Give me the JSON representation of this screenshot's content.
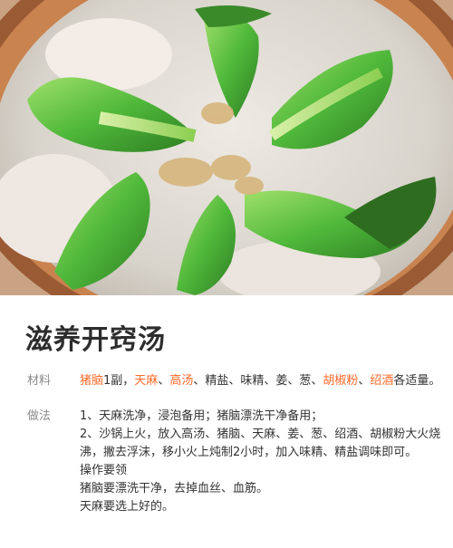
{
  "recipe": {
    "title": "滋养开窍汤",
    "materials_label": "材料",
    "materials": [
      {
        "text": "猪脑",
        "link": true
      },
      {
        "text": "1副，",
        "link": false
      },
      {
        "text": "天麻",
        "link": true
      },
      {
        "text": "、",
        "link": false
      },
      {
        "text": "高汤",
        "link": true
      },
      {
        "text": "、精盐、味精、姜、葱、",
        "link": false
      },
      {
        "text": "胡椒粉",
        "link": true
      },
      {
        "text": "、",
        "link": false
      },
      {
        "text": "绍酒",
        "link": true
      },
      {
        "text": "各适量。",
        "link": false
      }
    ],
    "method_label": "做法",
    "method_lines": [
      "1、天麻洗净，浸泡备用；猪脑漂洗干净备用；",
      "2、沙锅上火，放入高汤、猪脑、天麻、姜、葱、绍酒、胡椒粉大火烧",
      "沸，撇去浮沫，移小火上炖制2小时，加入味精、精盐调味即可。",
      "操作要领",
      "猪脑要漂洗干净，去掉血丝、血筋。",
      "天麻要选上好的。"
    ],
    "colors": {
      "link": "#ff6a2a",
      "label": "#8a8a8a",
      "text": "#333333"
    }
  }
}
